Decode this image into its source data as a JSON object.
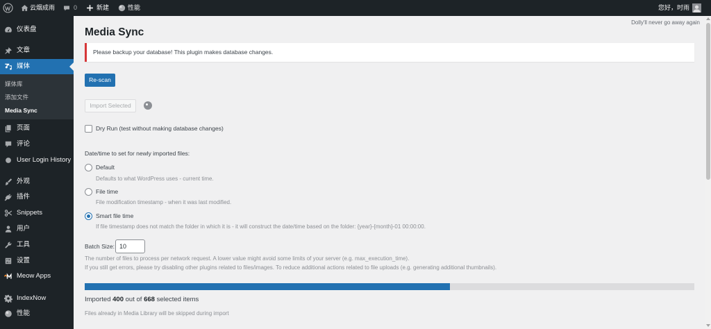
{
  "admin_bar": {
    "site_name": "云烟成雨",
    "comments_count": "0",
    "new_label": "新建",
    "performance_label": "性能",
    "greeting": "您好，时雨"
  },
  "sidebar": {
    "items": [
      {
        "label": "仪表盘",
        "icon": "dashboard-icon"
      },
      {
        "label": "文章",
        "icon": "pin-icon"
      },
      {
        "label": "媒体",
        "icon": "media-icon"
      },
      {
        "label": "页面",
        "icon": "page-icon"
      },
      {
        "label": "评论",
        "icon": "comment-icon"
      },
      {
        "label": "User Login History",
        "icon": "circle-icon"
      },
      {
        "label": "外观",
        "icon": "paintbrush-icon"
      },
      {
        "label": "插件",
        "icon": "plugin-icon"
      },
      {
        "label": "Snippets",
        "icon": "scissors-icon"
      },
      {
        "label": "用户",
        "icon": "user-icon"
      },
      {
        "label": "工具",
        "icon": "wrench-icon"
      },
      {
        "label": "设置",
        "icon": "settings-icon"
      },
      {
        "label": "Meow Apps",
        "icon": "meow-apps-icon"
      },
      {
        "label": "IndexNow",
        "icon": "gear-icon"
      },
      {
        "label": "性能",
        "icon": "performance-icon"
      }
    ],
    "submenu": [
      {
        "label": "媒体库"
      },
      {
        "label": "添加文件"
      },
      {
        "label": "Media Sync"
      }
    ]
  },
  "dolly": "Dolly'll never go away again",
  "page_title": "Media Sync",
  "notice": "Please backup your database! This plugin makes database changes.",
  "buttons": {
    "rescan": "Re-scan",
    "import_selected": "Import Selected"
  },
  "dry_run": {
    "label": "Dry Run (test without making database changes)",
    "checked": false
  },
  "datetime": {
    "heading": "Date/time to set for newly imported files:",
    "options": [
      {
        "label": "Default",
        "description": "Defaults to what WordPress uses - current time.",
        "checked": false
      },
      {
        "label": "File time",
        "description": "File modification timestamp - when it was last modified.",
        "checked": false
      },
      {
        "label": "Smart file time",
        "description": "If file timestamp does not match the folder in which it is - it will construct the date/time based on the folder: {year}-{month}-01 00:00:00.",
        "checked": true
      }
    ]
  },
  "batch": {
    "label": "Batch Size:",
    "value": "10",
    "help": [
      "The number of files to process per network request. A lower value might avoid some limits of your server (e.g. max_execution_time).",
      "If you still get errors, please try disabling other plugins related to files/images. To reduce additional actions related to file uploads (e.g. generating additional thumbnails)."
    ]
  },
  "progress": {
    "prefix": "Imported",
    "imported": 400,
    "middle": "out of",
    "total": 668,
    "suffix": "selected items",
    "note": "Files already in Media Library will be skipped during import"
  },
  "colors": {
    "accent": "#2271b1",
    "notice_error": "#d63638",
    "menu_bg": "#1d2327",
    "submenu_bg": "#2c3338",
    "page_bg": "#f0f0f1"
  }
}
